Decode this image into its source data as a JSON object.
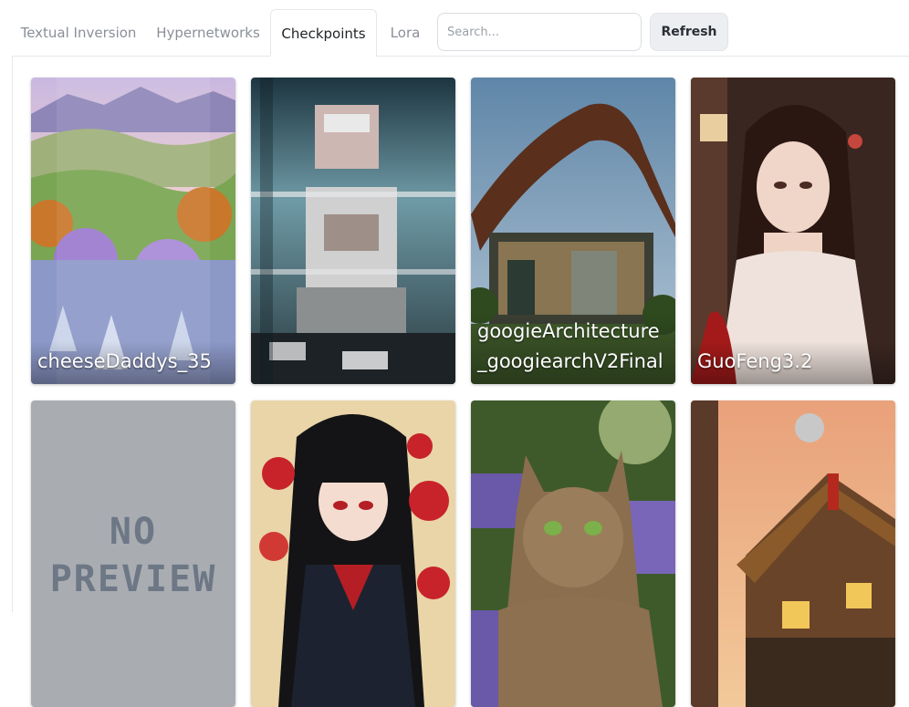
{
  "tabs": [
    {
      "label": "Textual Inversion",
      "active": false
    },
    {
      "label": "Hypernetworks",
      "active": false
    },
    {
      "label": "Checkpoints",
      "active": true
    },
    {
      "label": "Lora",
      "active": false
    }
  ],
  "search": {
    "placeholder": "Search...",
    "value": ""
  },
  "refresh_label": "Refresh",
  "cards": [
    {
      "name": "cheeseDaddys_35",
      "preview": "landscape-valley"
    },
    {
      "name": "",
      "preview": "pixelated-figure"
    },
    {
      "name": "googieArchitecture_googiearchV2Final",
      "preview": "googie-house"
    },
    {
      "name": "GuoFeng3.2",
      "preview": "portrait-woman"
    },
    {
      "name": "",
      "preview": "no-preview"
    },
    {
      "name": "",
      "preview": "anime-girl-flowers"
    },
    {
      "name": "",
      "preview": "tabby-cat"
    },
    {
      "name": "",
      "preview": "cottage-sunset"
    }
  ],
  "no_preview_text": {
    "line1": "NO",
    "line2": "PREVIEW"
  },
  "colors": {
    "accent": "#1f2328",
    "muted_tab": "#8a8f98",
    "no_preview_bg": "#a9adb2"
  }
}
